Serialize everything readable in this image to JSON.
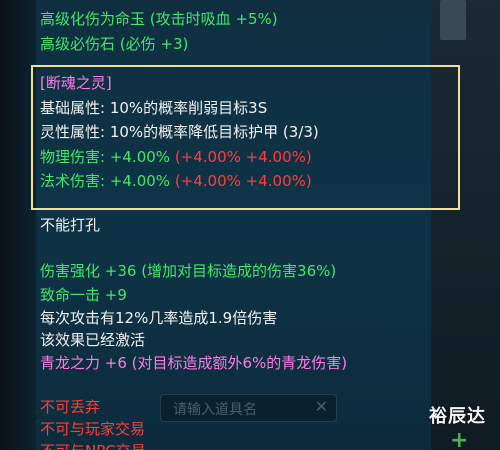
{
  "tooltip": {
    "top_lines": [
      {
        "text": "高级化伤为命玉 (攻击时吸血 +5%)",
        "color": "#3ee86d"
      },
      {
        "text": "高级必伤石 (必伤 +3)",
        "color": "#3ee86d"
      }
    ],
    "soul": {
      "title": "[断魂之灵]",
      "base_attr": "基础属性: 10%的概率削弱目标3S",
      "spirit_attr": "灵性属性: 10%的概率降低目标护甲 (3/3)",
      "phys_label": "物理伤害: +4.00%",
      "phys_extra": " (+4.00% +4.00%)",
      "magic_label": "法术伤害: +4.00%",
      "magic_extra": " (+4.00% +4.00%)"
    },
    "no_socket": "不能打孔",
    "damage_boost": "伤害强化 +36 (增加对目标造成的伤害36%)",
    "crit_label": "致命一击 +9",
    "crit_desc": "每次攻击有12%几率造成1.9倍伤害",
    "activated": "该效果已经激活",
    "dragon_power": "青龙之力 +6 (对目标造成额外6%的青龙伤害)",
    "restrictions": [
      "不可丢弃",
      "不可与玩家交易",
      "不可与NPC交易"
    ]
  },
  "background": {
    "search_placeholder": "请输入道具名",
    "search_clear": "✕"
  },
  "watermark": "裕辰达",
  "colors": {
    "green": "#3ee86d",
    "white": "#f2f2f2",
    "red": "#ff3d3d",
    "pink": "#ff7ce6",
    "highlight_border": "#f1e09a"
  }
}
